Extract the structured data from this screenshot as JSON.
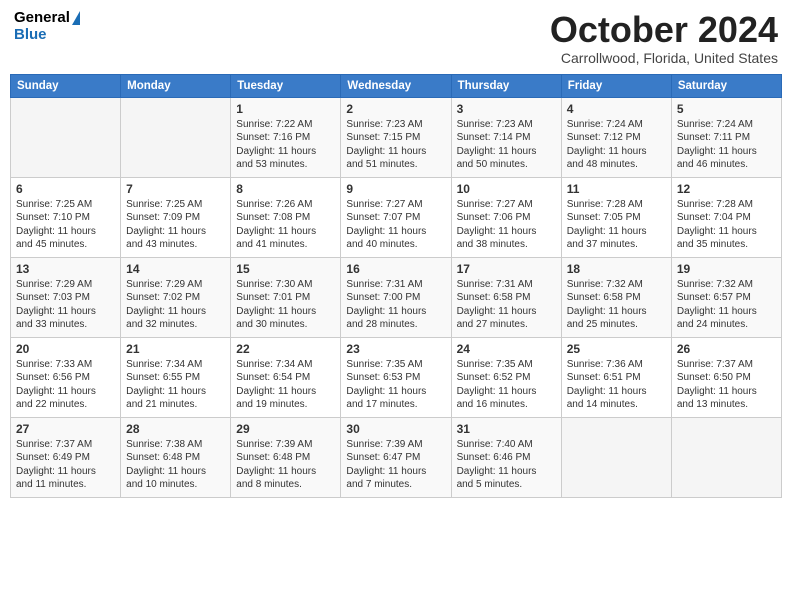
{
  "header": {
    "logo_general": "General",
    "logo_blue": "Blue",
    "month_title": "October 2024",
    "location": "Carrollwood, Florida, United States"
  },
  "days_of_week": [
    "Sunday",
    "Monday",
    "Tuesday",
    "Wednesday",
    "Thursday",
    "Friday",
    "Saturday"
  ],
  "weeks": [
    [
      {
        "day": "",
        "sunrise": "",
        "sunset": "",
        "daylight": "",
        "empty": true
      },
      {
        "day": "",
        "sunrise": "",
        "sunset": "",
        "daylight": "",
        "empty": true
      },
      {
        "day": "1",
        "sunrise": "Sunrise: 7:22 AM",
        "sunset": "Sunset: 7:16 PM",
        "daylight": "Daylight: 11 hours and 53 minutes."
      },
      {
        "day": "2",
        "sunrise": "Sunrise: 7:23 AM",
        "sunset": "Sunset: 7:15 PM",
        "daylight": "Daylight: 11 hours and 51 minutes."
      },
      {
        "day": "3",
        "sunrise": "Sunrise: 7:23 AM",
        "sunset": "Sunset: 7:14 PM",
        "daylight": "Daylight: 11 hours and 50 minutes."
      },
      {
        "day": "4",
        "sunrise": "Sunrise: 7:24 AM",
        "sunset": "Sunset: 7:12 PM",
        "daylight": "Daylight: 11 hours and 48 minutes."
      },
      {
        "day": "5",
        "sunrise": "Sunrise: 7:24 AM",
        "sunset": "Sunset: 7:11 PM",
        "daylight": "Daylight: 11 hours and 46 minutes."
      }
    ],
    [
      {
        "day": "6",
        "sunrise": "Sunrise: 7:25 AM",
        "sunset": "Sunset: 7:10 PM",
        "daylight": "Daylight: 11 hours and 45 minutes."
      },
      {
        "day": "7",
        "sunrise": "Sunrise: 7:25 AM",
        "sunset": "Sunset: 7:09 PM",
        "daylight": "Daylight: 11 hours and 43 minutes."
      },
      {
        "day": "8",
        "sunrise": "Sunrise: 7:26 AM",
        "sunset": "Sunset: 7:08 PM",
        "daylight": "Daylight: 11 hours and 41 minutes."
      },
      {
        "day": "9",
        "sunrise": "Sunrise: 7:27 AM",
        "sunset": "Sunset: 7:07 PM",
        "daylight": "Daylight: 11 hours and 40 minutes."
      },
      {
        "day": "10",
        "sunrise": "Sunrise: 7:27 AM",
        "sunset": "Sunset: 7:06 PM",
        "daylight": "Daylight: 11 hours and 38 minutes."
      },
      {
        "day": "11",
        "sunrise": "Sunrise: 7:28 AM",
        "sunset": "Sunset: 7:05 PM",
        "daylight": "Daylight: 11 hours and 37 minutes."
      },
      {
        "day": "12",
        "sunrise": "Sunrise: 7:28 AM",
        "sunset": "Sunset: 7:04 PM",
        "daylight": "Daylight: 11 hours and 35 minutes."
      }
    ],
    [
      {
        "day": "13",
        "sunrise": "Sunrise: 7:29 AM",
        "sunset": "Sunset: 7:03 PM",
        "daylight": "Daylight: 11 hours and 33 minutes."
      },
      {
        "day": "14",
        "sunrise": "Sunrise: 7:29 AM",
        "sunset": "Sunset: 7:02 PM",
        "daylight": "Daylight: 11 hours and 32 minutes."
      },
      {
        "day": "15",
        "sunrise": "Sunrise: 7:30 AM",
        "sunset": "Sunset: 7:01 PM",
        "daylight": "Daylight: 11 hours and 30 minutes."
      },
      {
        "day": "16",
        "sunrise": "Sunrise: 7:31 AM",
        "sunset": "Sunset: 7:00 PM",
        "daylight": "Daylight: 11 hours and 28 minutes."
      },
      {
        "day": "17",
        "sunrise": "Sunrise: 7:31 AM",
        "sunset": "Sunset: 6:58 PM",
        "daylight": "Daylight: 11 hours and 27 minutes."
      },
      {
        "day": "18",
        "sunrise": "Sunrise: 7:32 AM",
        "sunset": "Sunset: 6:58 PM",
        "daylight": "Daylight: 11 hours and 25 minutes."
      },
      {
        "day": "19",
        "sunrise": "Sunrise: 7:32 AM",
        "sunset": "Sunset: 6:57 PM",
        "daylight": "Daylight: 11 hours and 24 minutes."
      }
    ],
    [
      {
        "day": "20",
        "sunrise": "Sunrise: 7:33 AM",
        "sunset": "Sunset: 6:56 PM",
        "daylight": "Daylight: 11 hours and 22 minutes."
      },
      {
        "day": "21",
        "sunrise": "Sunrise: 7:34 AM",
        "sunset": "Sunset: 6:55 PM",
        "daylight": "Daylight: 11 hours and 21 minutes."
      },
      {
        "day": "22",
        "sunrise": "Sunrise: 7:34 AM",
        "sunset": "Sunset: 6:54 PM",
        "daylight": "Daylight: 11 hours and 19 minutes."
      },
      {
        "day": "23",
        "sunrise": "Sunrise: 7:35 AM",
        "sunset": "Sunset: 6:53 PM",
        "daylight": "Daylight: 11 hours and 17 minutes."
      },
      {
        "day": "24",
        "sunrise": "Sunrise: 7:35 AM",
        "sunset": "Sunset: 6:52 PM",
        "daylight": "Daylight: 11 hours and 16 minutes."
      },
      {
        "day": "25",
        "sunrise": "Sunrise: 7:36 AM",
        "sunset": "Sunset: 6:51 PM",
        "daylight": "Daylight: 11 hours and 14 minutes."
      },
      {
        "day": "26",
        "sunrise": "Sunrise: 7:37 AM",
        "sunset": "Sunset: 6:50 PM",
        "daylight": "Daylight: 11 hours and 13 minutes."
      }
    ],
    [
      {
        "day": "27",
        "sunrise": "Sunrise: 7:37 AM",
        "sunset": "Sunset: 6:49 PM",
        "daylight": "Daylight: 11 hours and 11 minutes."
      },
      {
        "day": "28",
        "sunrise": "Sunrise: 7:38 AM",
        "sunset": "Sunset: 6:48 PM",
        "daylight": "Daylight: 11 hours and 10 minutes."
      },
      {
        "day": "29",
        "sunrise": "Sunrise: 7:39 AM",
        "sunset": "Sunset: 6:48 PM",
        "daylight": "Daylight: 11 hours and 8 minutes."
      },
      {
        "day": "30",
        "sunrise": "Sunrise: 7:39 AM",
        "sunset": "Sunset: 6:47 PM",
        "daylight": "Daylight: 11 hours and 7 minutes."
      },
      {
        "day": "31",
        "sunrise": "Sunrise: 7:40 AM",
        "sunset": "Sunset: 6:46 PM",
        "daylight": "Daylight: 11 hours and 5 minutes."
      },
      {
        "day": "",
        "sunrise": "",
        "sunset": "",
        "daylight": "",
        "empty": true
      },
      {
        "day": "",
        "sunrise": "",
        "sunset": "",
        "daylight": "",
        "empty": true
      }
    ]
  ]
}
